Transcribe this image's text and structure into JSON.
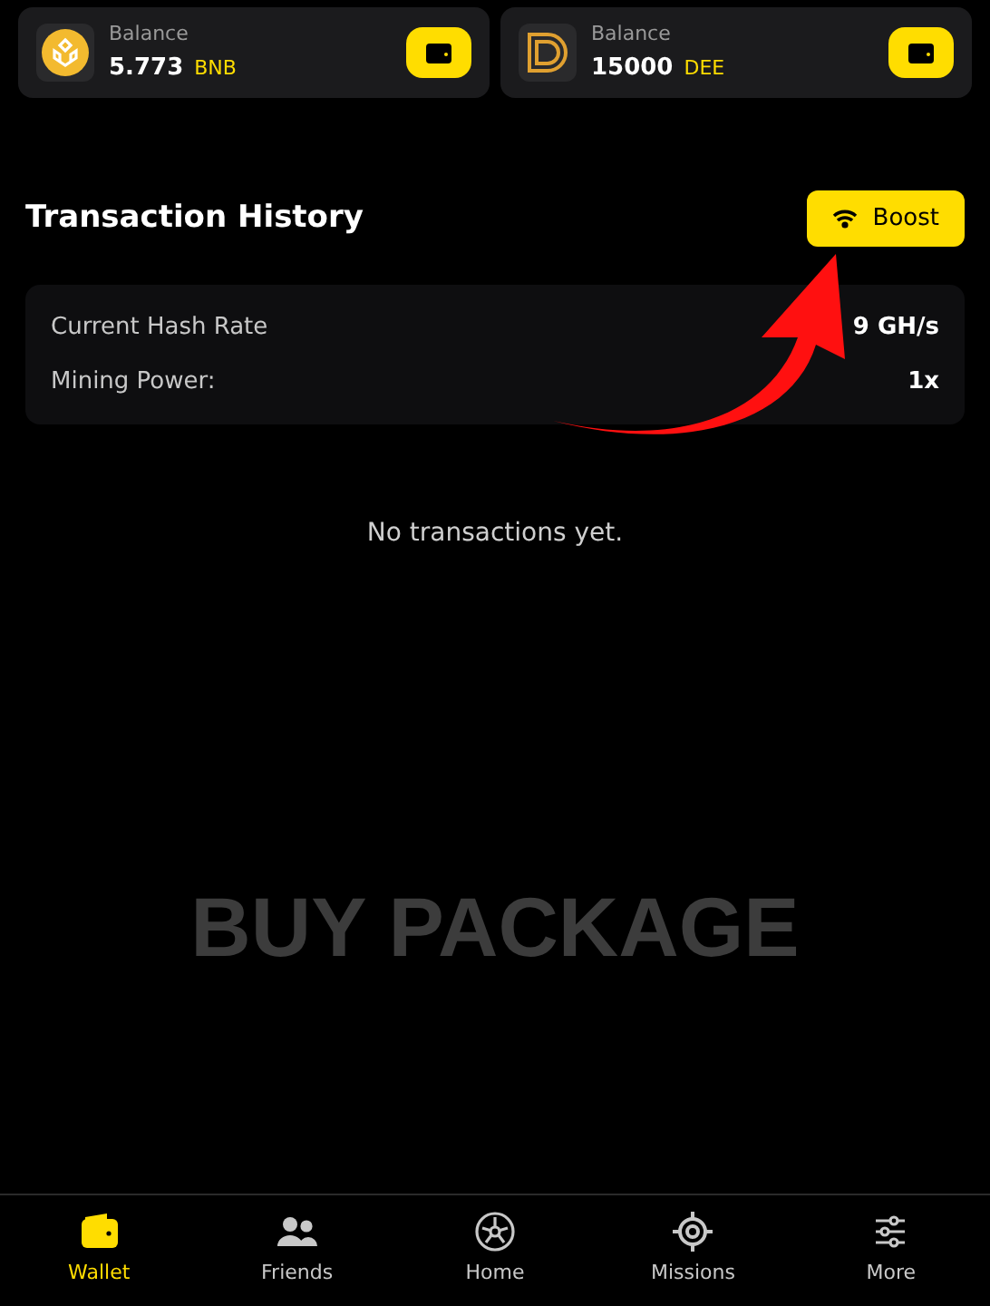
{
  "balances": [
    {
      "label": "Balance",
      "amount": "5.773",
      "currency": "BNB",
      "kind": "bnb"
    },
    {
      "label": "Balance",
      "amount": "15000",
      "currency": "DEE",
      "kind": "dee"
    }
  ],
  "section": {
    "title": "Transaction History",
    "button": "Boost"
  },
  "stats": [
    {
      "label": "Current Hash Rate",
      "value": "9 GH/s"
    },
    {
      "label": "Mining Power:",
      "value": "1x"
    }
  ],
  "empty_message": "No transactions yet.",
  "overlay_caption": "BUY PACKAGE",
  "nav": [
    {
      "label": "Wallet",
      "kind": "wallet",
      "selected": true
    },
    {
      "label": "Friends",
      "kind": "friends",
      "selected": false
    },
    {
      "label": "Home",
      "kind": "home",
      "selected": false
    },
    {
      "label": "Missions",
      "kind": "missions",
      "selected": false
    },
    {
      "label": "More",
      "kind": "more",
      "selected": false
    }
  ]
}
